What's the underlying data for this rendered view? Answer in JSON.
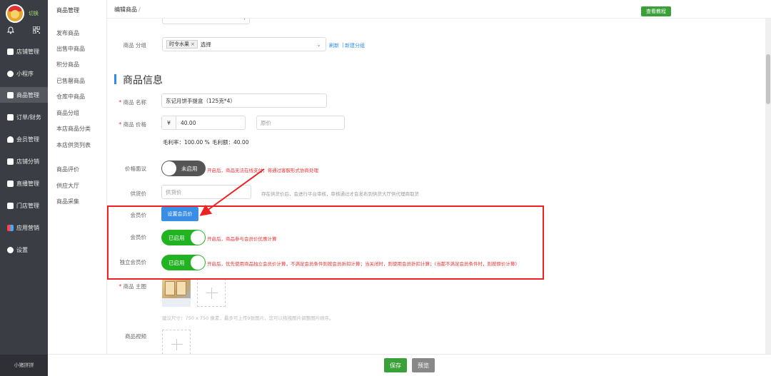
{
  "sidebar": {
    "brand": "切换",
    "items": [
      {
        "label": "店铺管理"
      },
      {
        "label": "小程序"
      },
      {
        "label": "商品管理"
      },
      {
        "label": "订单/财务"
      },
      {
        "label": "会员管理"
      },
      {
        "label": "店铺分销"
      },
      {
        "label": "直播管理"
      },
      {
        "label": "门店管理"
      },
      {
        "label": "应用营销"
      },
      {
        "label": "设置"
      }
    ],
    "footer": "小猪拼拼"
  },
  "submenu": {
    "title": "商品管理",
    "items": [
      {
        "label": "发布商品"
      },
      {
        "label": "出售中商品"
      },
      {
        "label": "积分商品"
      },
      {
        "label": "已售罄商品"
      },
      {
        "label": "仓库中商品"
      },
      {
        "label": "商品分组"
      },
      {
        "label": "本店商品分类"
      },
      {
        "label": "本店供货列表"
      },
      {
        "label": "商品评价"
      },
      {
        "label": "供应大厅"
      },
      {
        "label": "商品采集"
      }
    ]
  },
  "topbar": {
    "breadcrumb": "编辑商品",
    "separator": "/",
    "tutorial_button": "查看教程"
  },
  "form": {
    "group": {
      "label": "商品 分组",
      "tag": "时令水果",
      "tag_remove": "×",
      "placeholder": "选择",
      "refresh_link": "刷新",
      "divider": "|",
      "new_group_link": "新建分组"
    },
    "section_title": "商品信息",
    "name": {
      "label": "商品 名称",
      "value": "东记月饼手提盒（125克*4）"
    },
    "price": {
      "label": "商品 价格",
      "currency": "¥",
      "value": "40.00",
      "original_placeholder": "原价"
    },
    "margin": {
      "rate": "毛利率：100.00 %",
      "amount": "毛利额：40.00"
    },
    "price_negotiable": {
      "label": "价格面议",
      "switch_text": "未启用",
      "hint": "开启后，商品无法在线支付，将通过客服形式协商处理"
    },
    "supply_price": {
      "label": "供货价",
      "placeholder": "供货价",
      "hint": "存在供货价后，会进行平台审核，审核通过才会发布到供货大厅供代理商取货"
    },
    "member_price_setting": {
      "label": "会员价",
      "button": "设置会员价"
    },
    "member_price": {
      "label": "会员价",
      "switch_text": "已启用",
      "hint": "开启后，商品参与会员价优惠计算"
    },
    "independent_member_price": {
      "label": "独立会员价",
      "switch_text": "已启用",
      "hint": "开启后，优先使用商品独立会员价计算，不满足会员条件则按会员折扣计算；当关闭时，则使用会员折扣计算；(当都不满足会员条件时，则按原价计算)"
    },
    "main_image": {
      "label": "商品 主图",
      "hint": "建议尺寸：750 x 750 像素，最多可上传9张图片，您可以拖拽图片调整图片顺序。"
    },
    "video": {
      "label": "商品视频"
    }
  },
  "bottombar": {
    "save": "保存",
    "preview": "预览"
  },
  "colors": {
    "accent_green": "#3aa13a",
    "link_blue": "#2d8cf0",
    "warn_red": "#e33333",
    "sidebar_dark": "#3a3d43"
  }
}
